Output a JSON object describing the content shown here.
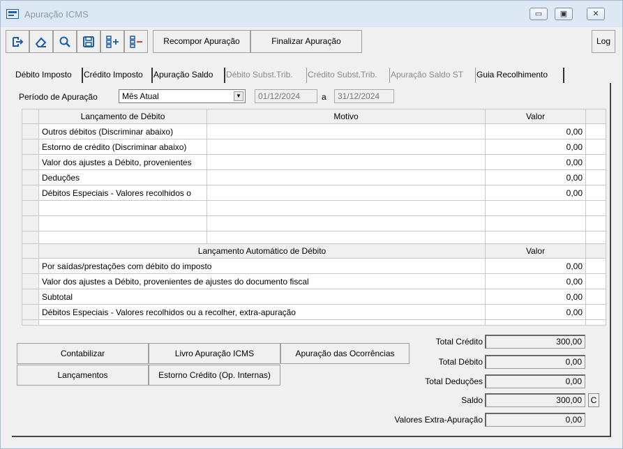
{
  "window": {
    "title": "Apuração ICMS",
    "btn_minimize": "▭",
    "btn_restore": "▣",
    "btn_close": "✕"
  },
  "toolbar": {
    "icons": [
      "exit-icon",
      "eraser-icon",
      "search-icon",
      "save-icon",
      "add-list-icon",
      "remove-list-icon"
    ],
    "recompor_label": "Recompor Apuração",
    "finalizar_label": "Finalizar Apuração",
    "log_label": "Log"
  },
  "tabs": [
    {
      "label": "Débito Imposto",
      "active": true
    },
    {
      "label": "Crédito Imposto",
      "active": false
    },
    {
      "label": "Apuração Saldo",
      "active": false
    },
    {
      "label": "Débito Subst.Trib.",
      "disabled": true
    },
    {
      "label": "Crédito Subst.Trib.",
      "disabled": true
    },
    {
      "label": "Apuração Saldo ST",
      "disabled": true
    },
    {
      "label": "Guia Recolhimento",
      "active": false
    }
  ],
  "periodo": {
    "label": "Período de Apuração",
    "selected": "Mês Atual",
    "from": "01/12/2024",
    "sep": "a",
    "to": "31/12/2024"
  },
  "debito_table": {
    "headers": [
      "Lançamento de Débito",
      "Motivo",
      "Valor"
    ],
    "rows": [
      {
        "lancamento": "Outros débitos (Discriminar abaixo)",
        "motivo": "",
        "valor": "0,00"
      },
      {
        "lancamento": "Estorno de crédito (Discriminar abaixo)",
        "motivo": "",
        "valor": "0,00"
      },
      {
        "lancamento": "Valor dos ajustes a Débito, provenientes",
        "motivo": "",
        "valor": "0,00"
      },
      {
        "lancamento": "Deduções",
        "motivo": "",
        "valor": "0,00"
      },
      {
        "lancamento": "Débitos Especiais - Valores recolhidos o",
        "motivo": "",
        "valor": "0,00"
      }
    ]
  },
  "auto_table": {
    "headers": [
      "Lançamento Automático de Débito",
      "Valor"
    ],
    "rows": [
      {
        "lancamento": "Por saídas/prestações com débito do imposto",
        "valor": "0,00"
      },
      {
        "lancamento": "Valor dos ajustes a Débito, provenientes de ajustes do documento fiscal",
        "valor": "0,00"
      },
      {
        "lancamento": "Subtotal",
        "valor": "0,00"
      },
      {
        "lancamento": "Débitos Especiais - Valores recolhidos ou a recolher, extra-apuração",
        "valor": "0,00"
      }
    ]
  },
  "buttons": {
    "contabilizar": "Contabilizar",
    "livro": "Livro Apuração ICMS",
    "ocorrencias": "Apuração das Ocorrências",
    "lancamentos": "Lançamentos",
    "estorno": "Estorno Crédito (Op. Internas)"
  },
  "totals": {
    "total_credito_label": "Total Crédito",
    "total_credito": "300,00",
    "total_debito_label": "Total Débito",
    "total_debito": "0,00",
    "total_deducoes_label": "Total Deduções",
    "total_deducoes": "0,00",
    "saldo_label": "Saldo",
    "saldo": "300,00",
    "saldo_tipo": "C",
    "extra_label": "Valores Extra-Apuração",
    "extra": "0,00"
  }
}
